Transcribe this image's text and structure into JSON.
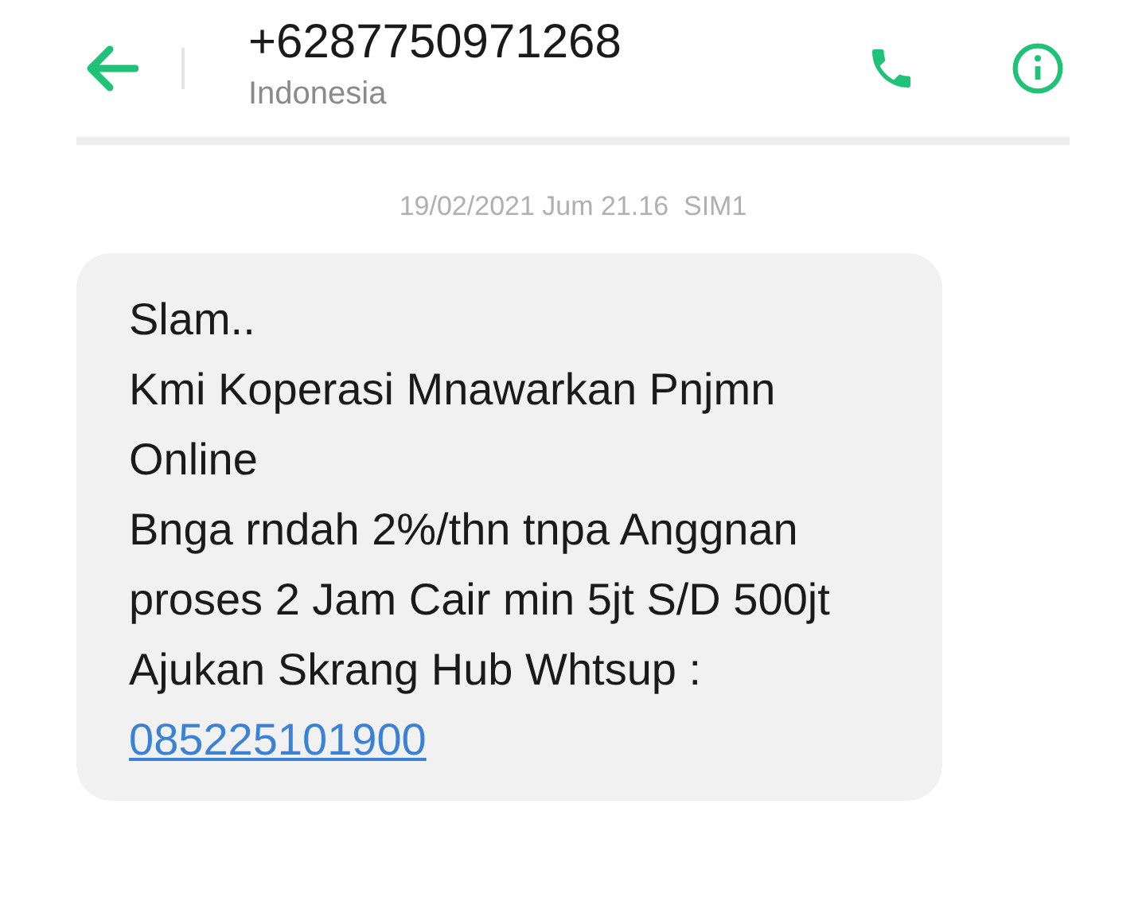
{
  "header": {
    "title": "+6287750971268",
    "subtitle": "Indonesia"
  },
  "timestamp": "19/02/2021 Jum 21.16  SIM1",
  "message": {
    "lines": [
      "Slam..",
      "Kmi Koperasi Mnawarkan Pnjmn Online",
      "Bnga rndah 2%/thn tnpa Anggnan",
      "proses 2 Jam Cair min 5jt S/D 500jt",
      "Ajukan Skrang Hub Whtsup :"
    ],
    "link": "085225101900"
  }
}
